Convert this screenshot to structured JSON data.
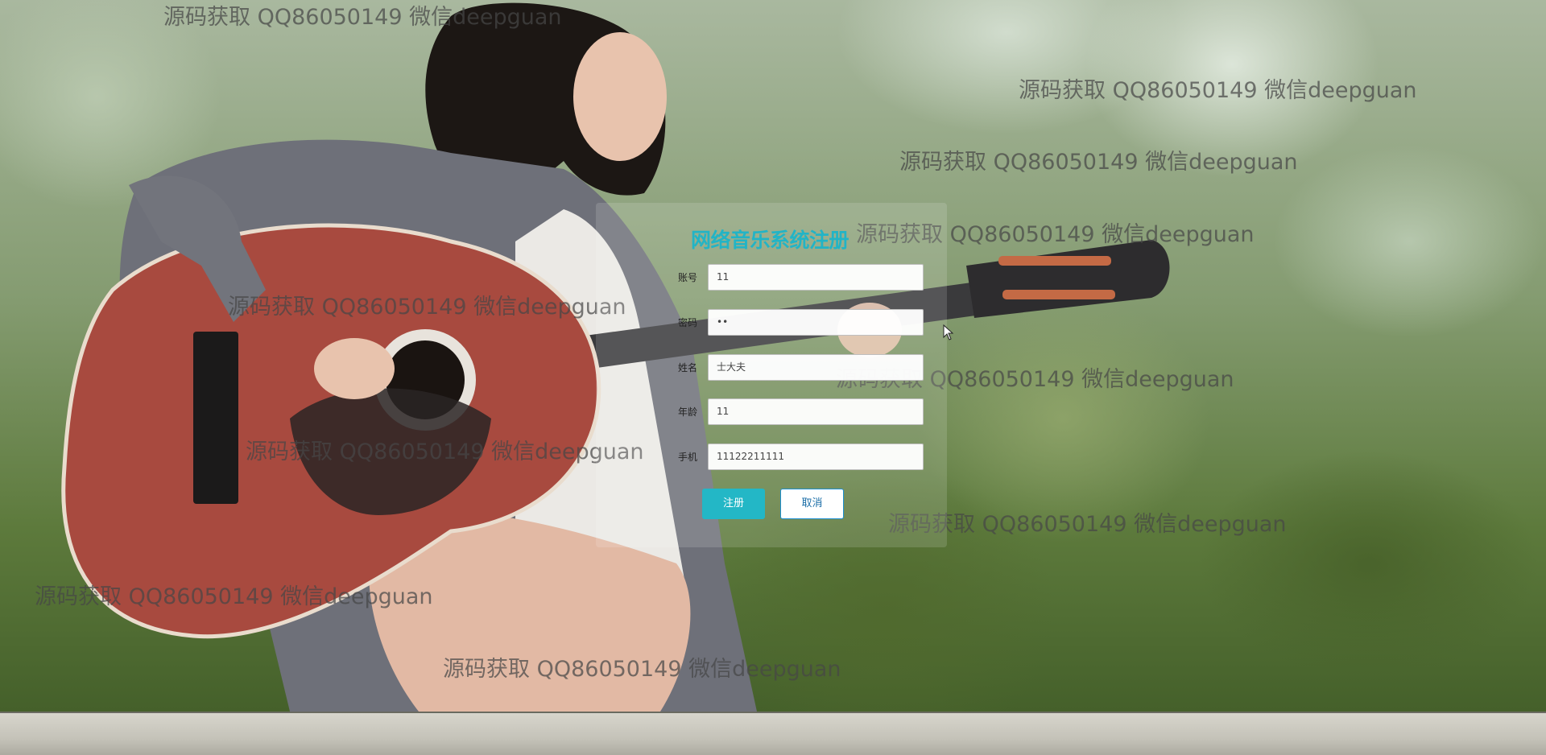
{
  "form": {
    "title": "网络音乐系统注册",
    "fields": [
      {
        "label": "账号",
        "value": "11"
      },
      {
        "label": "密码",
        "value": "••"
      },
      {
        "label": "姓名",
        "value": "士大夫"
      },
      {
        "label": "年龄",
        "value": "11"
      },
      {
        "label": "手机",
        "value": "11122211111"
      }
    ],
    "register_label": "注册",
    "cancel_label": "取消"
  },
  "watermark": {
    "text": "源码获取 QQ86050149 微信deepguan"
  },
  "colors": {
    "accent": "#23b7c6",
    "cancel_border": "#1c8fd0"
  }
}
